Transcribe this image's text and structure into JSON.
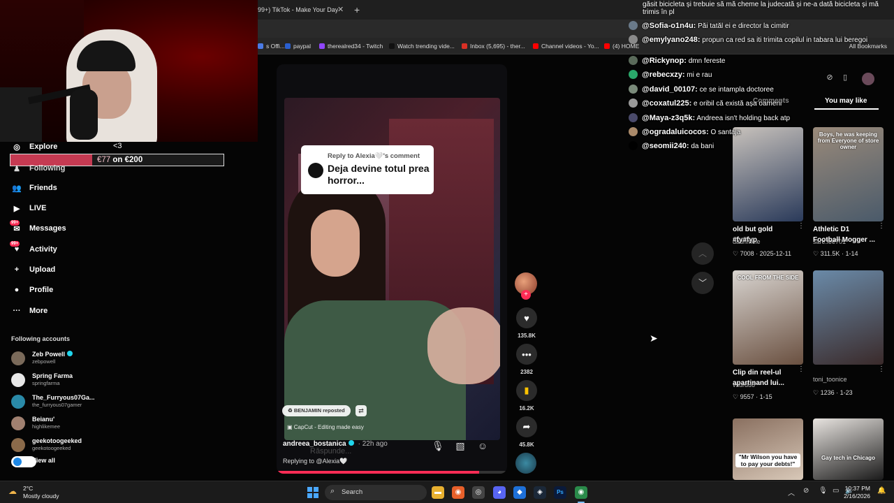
{
  "browser": {
    "tab_title": "99+) TikTok - Make Your Day",
    "tab_close": "✕",
    "new_tab": "+",
    "bookmarks": [
      {
        "label": "s Offi...",
        "color": "#4b7be5"
      },
      {
        "label": "paypal",
        "color": "#2a5fcf"
      },
      {
        "label": "therealred34 - Twitch",
        "color": "#9146ff"
      },
      {
        "label": "Watch trending vide...",
        "color": "#111111"
      },
      {
        "label": "Inbox (5,695) - ther...",
        "color": "#d93025"
      },
      {
        "label": "Channel videos - Yo...",
        "color": "#ff0000"
      },
      {
        "label": "(4) HOME",
        "color": "#ff0000"
      }
    ],
    "all_bookmarks": "All Bookmarks"
  },
  "donation_goal": {
    "current": "€77",
    "text": " on €200",
    "progress": 0.385
  },
  "sidebar": {
    "items": [
      {
        "label": "Explore",
        "icon": "◎"
      },
      {
        "label": "Following",
        "icon": "♟"
      },
      {
        "label": "Friends",
        "icon": "👥"
      },
      {
        "label": "LIVE",
        "icon": "▶"
      },
      {
        "label": "Messages",
        "icon": "✉",
        "badge": "99+"
      },
      {
        "label": "Activity",
        "icon": "♥",
        "badge": "99+"
      },
      {
        "label": "Upload",
        "icon": "+"
      },
      {
        "label": "Profile",
        "icon": "●"
      },
      {
        "label": "More",
        "icon": "···"
      }
    ],
    "explore_heart": "<3",
    "following_accounts_title": "Following accounts",
    "accounts": [
      {
        "name": "Zeb Powell",
        "handle": "zebpowell",
        "verified": true,
        "color": "#7a6a5a"
      },
      {
        "name": "Spring Farma",
        "handle": "springfarma",
        "verified": false,
        "color": "#e8e8e8"
      },
      {
        "name": "The_Furryous07Ga...",
        "handle": "the_furryous07gamer",
        "verified": false,
        "color": "#2a8aa8"
      },
      {
        "name": "Beianu'",
        "handle": "highlikemee",
        "verified": false,
        "color": "#a08070"
      },
      {
        "name": "geekotoogeeked",
        "handle": "geekotoogeeked",
        "verified": false,
        "color": "#8a6a4a"
      }
    ],
    "view_all": "View all"
  },
  "video": {
    "reply_label": "Reply to Alexia🤍's comment",
    "reply_text": "Deja devine totul prea horror...",
    "repost_label": "BENJAMIN reposted",
    "capcut_label": "CapCut - Editing made easy",
    "author": "andreea_bostanica",
    "ago": "· 22h ago",
    "reply_placeholder": "Răspunde...",
    "replying_to": "Replying to @Alexia🤍",
    "progress": 0.88
  },
  "actions": {
    "likes": "135.8K",
    "comments": "2382",
    "saves": "16.2K",
    "shares": "45.8K"
  },
  "chat": {
    "top_line": "găsit bicicleta și trebuie să mă cheme la judecată și ne-a dată bicicleta și mă trimis în pl",
    "messages": [
      {
        "user": "@Sofia-o1n4u:",
        "text": "Păi tatăl ei e director la cimitir",
        "color": "#6a7a8a"
      },
      {
        "user": "@emylyano248:",
        "text": "propun ca red sa iti trimita copilul in tabara lui beregoi",
        "color": "#8a8a8a"
      },
      {
        "user": "@Rickynop:",
        "text": "dmn fereste",
        "color": "#5a6a5a"
      },
      {
        "user": "@rebecxzy:",
        "text": "mi e rau",
        "color": "#2aa86a"
      },
      {
        "user": "@david_00107:",
        "text": "ce se intampla doctoree",
        "color": "#7a8a7a"
      },
      {
        "user": "@coxatul225:",
        "text": "e oribil că există așa oameni",
        "color": "#9a9a9a"
      },
      {
        "user": "@Maya-z3q5k:",
        "text": "Andreea isn't holding back atp",
        "color": "#4a4a6a"
      },
      {
        "user": "@ogradaluicocos:",
        "text": "O santaja",
        "color": "#aa8a6a"
      },
      {
        "user": "@seomii240:",
        "text": "da bani",
        "color": "#000000"
      }
    ]
  },
  "right_panel": {
    "tab_comments": "Comments",
    "tab_you_may_like": "You may like",
    "cards": [
      {
        "title": "old but gold #fy#fyp",
        "author": "daurimele",
        "likes": "7008",
        "date": "2025-12-11",
        "caption": "",
        "colors": [
          "#c8c2bc",
          "#2a3a5a"
        ]
      },
      {
        "title": "Athletic D1 Football Mogger ...",
        "author": "sare.lee701",
        "likes": "311.5K",
        "date": "1-14",
        "caption": "Boys, he was keeping from Everyone of store owner",
        "colors": [
          "#9a8a7a",
          "#4a5a6a"
        ]
      },
      {
        "title": "Clip din reel-ul apartinand lui...",
        "author": "vsurdu6",
        "likes": "9557",
        "date": "1-15",
        "caption": "COOL FROM THE SIDE",
        "colors": [
          "#d8d4d0",
          "#6a5040"
        ]
      },
      {
        "title": "",
        "author": "toni_toonice",
        "likes": "1236",
        "date": "1-23",
        "caption": "",
        "colors": [
          "#6a8aa8",
          "#3a2a2a"
        ]
      },
      {
        "title": "",
        "author": "",
        "likes": "",
        "date": "",
        "caption": "\"Mr Wilson you have to pay your debts!\"",
        "colors": [
          "#8a7060",
          "#d8c8b8"
        ]
      },
      {
        "title": "",
        "author": "",
        "likes": "",
        "date": "",
        "caption": "Gay tech in Chicago",
        "colors": [
          "#e8e4e0",
          "#1a1a1a"
        ]
      }
    ]
  },
  "taskbar": {
    "temp": "2°C",
    "weather": "Mostly cloudy",
    "search": "Search",
    "time": "10:37 PM",
    "date": "2/16/2026",
    "apps": [
      {
        "name": "file-explorer-icon",
        "glyph": "▬",
        "bg": "#e8b030"
      },
      {
        "name": "firefox-icon",
        "glyph": "◉",
        "bg": "#e8602a"
      },
      {
        "name": "chrome-dev-icon",
        "glyph": "◎",
        "bg": "#444444"
      },
      {
        "name": "discord-icon",
        "glyph": "◕",
        "bg": "#5865f2"
      },
      {
        "name": "steam-icon",
        "glyph": "◈",
        "bg": "#1b2838"
      },
      {
        "name": "app-icon",
        "glyph": "◆",
        "bg": "#1e70d8"
      },
      {
        "name": "photoshop-icon",
        "glyph": "Ps",
        "bg": "#0a1a3a"
      },
      {
        "name": "chrome-icon",
        "glyph": "◉",
        "bg": "#2a8a4a"
      }
    ]
  }
}
